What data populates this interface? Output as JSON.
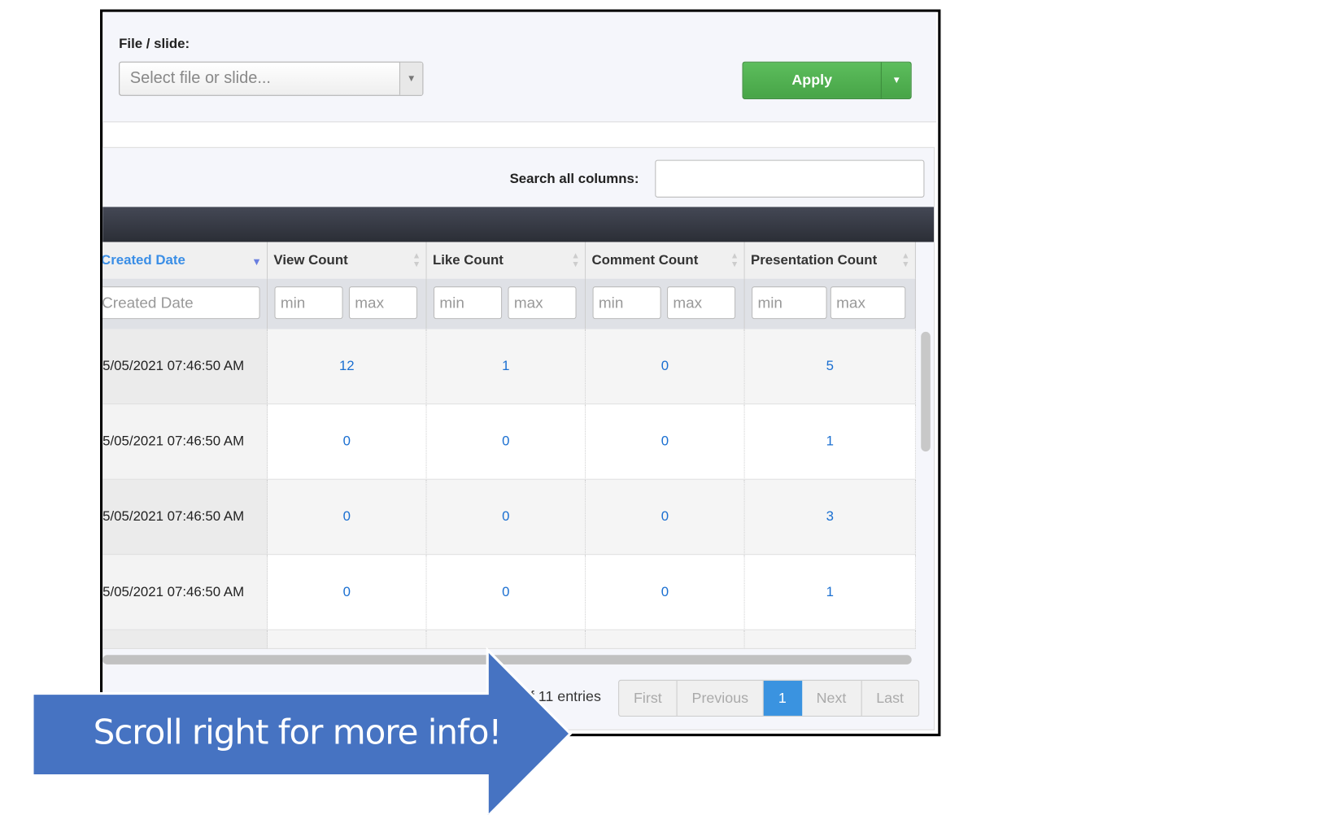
{
  "filters": {
    "file_label": "File / slide:",
    "file_placeholder": "Select file or slide...",
    "apply_label": "Apply"
  },
  "table": {
    "search_label": "Search all columns:",
    "search_value": "",
    "columns": [
      "Created Date",
      "View Count",
      "Like Count",
      "Comment Count",
      "Presentation Count"
    ],
    "sorted_column": "Created Date",
    "filter_placeholders": {
      "date": "Created Date",
      "min": "min",
      "max": "max"
    },
    "rows": [
      {
        "created": "5/05/2021 07:46:50 AM",
        "views": "12",
        "likes": "1",
        "comments": "0",
        "presentations": "5"
      },
      {
        "created": "5/05/2021 07:46:50 AM",
        "views": "0",
        "likes": "0",
        "comments": "0",
        "presentations": "1"
      },
      {
        "created": "5/05/2021 07:46:50 AM",
        "views": "0",
        "likes": "0",
        "comments": "0",
        "presentations": "3"
      },
      {
        "created": "5/05/2021 07:46:50 AM",
        "views": "0",
        "likes": "0",
        "comments": "0",
        "presentations": "1"
      }
    ],
    "entries_text": "f 11 entries",
    "pagination": {
      "first": "First",
      "previous": "Previous",
      "current": "1",
      "next": "Next",
      "last": "Last"
    }
  },
  "callout": {
    "text": "Scroll right for more info!",
    "color": "#4673c2"
  },
  "colors": {
    "apply": "#4cae4c",
    "link": "#1a6fd1",
    "sorted_header": "#3a8ee6",
    "active_page": "#3a93e0"
  }
}
